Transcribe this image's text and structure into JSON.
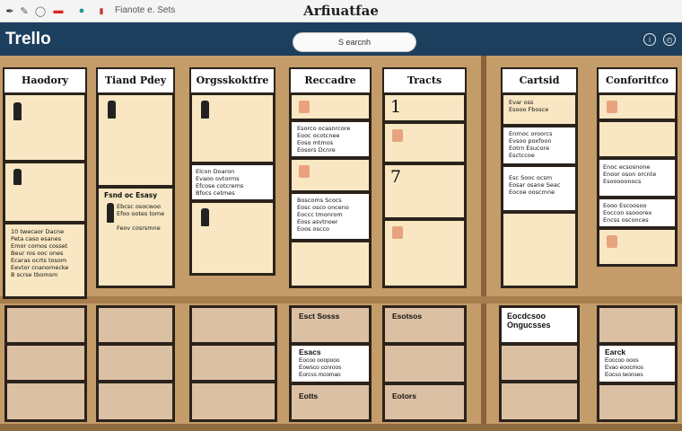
{
  "toolbar": {
    "icons": [
      "pen-icon",
      "pencil-icon",
      "drop-icon",
      "eraser-icon",
      "brush-icon",
      "marker-icon"
    ],
    "text": "Fianote e. Sets",
    "title": "Arfiuatfae"
  },
  "app": {
    "logo": "Trello",
    "search_label": "S earcnh",
    "icons": [
      "info-icon",
      "clock-icon"
    ]
  },
  "columns": [
    {
      "title": "Haodory"
    },
    {
      "title": "Tiand Pdey"
    },
    {
      "title": "Orgsskoktfre"
    },
    {
      "title": "Reccadre"
    },
    {
      "title": "Tracts"
    },
    {
      "title": "Cartsid"
    },
    {
      "title": "Conforitfco"
    }
  ],
  "cards": {
    "c1_note": "10 twecaor Dacne\nPeta caso esanes\nEmor comos cosset\nBeur ros ooc ones\nEcaras ocrts tosom\nEevtor cnanomecke\nB scrse tbomsm",
    "c2_note_head": "Fsnd oc Esasy",
    "c2_note": "Ebcsc osocwoo\nEfoo ootes tome\n\nFeov cosrsmne",
    "c3_note": "Elcon Doaron\nEvaoo ovtorms\nEfcose cotcrems\nBfocs cetmes",
    "c4_note1": "Esorco ocasnrcore\nEooc ocotcnee\nEoso mtmos\nEosors Dcnre",
    "c4_note2": "Boscoms Scocs\nEosc osco onceno\nEoccc tmonrom\nEoss asvtnoer\nEoos oscco",
    "c5_num1": "1",
    "c5_num2": "7",
    "c6_note1": "Enrnoc oroorcs\nEvsoo poxfoon\nEotrn Esucore\nEsctccoe",
    "c6_note2": "Esc Sooc ocsm\nEosar osane Seac\nEocoe ooscmne",
    "c6_top": "Evar oss\nEsooo Fbosce",
    "c7_note1": "Enoc ecsosnone\nEnoor oson orcnte\nEsooooonocs",
    "c7_note2": "Eooo Escoosoo\nEoccon ssooorex\nEncss osconces"
  },
  "bottom": {
    "b4_top": "Esct Sosss",
    "b4_mid_head": "Esacs",
    "b4_mid": "Eocoo ooopooo\nEowsco ccnroos\nEorcss mcomao",
    "b4_bot": "Eotts",
    "b5_top": "Esotsos",
    "b5_bot": "Eotors",
    "b6_top": "Eocdcsoo\nOngucsses",
    "b7_mid_head": "Earck",
    "b7_mid": "Eoccoo ooos\nEvao eoocmos\nEocso teonses"
  }
}
